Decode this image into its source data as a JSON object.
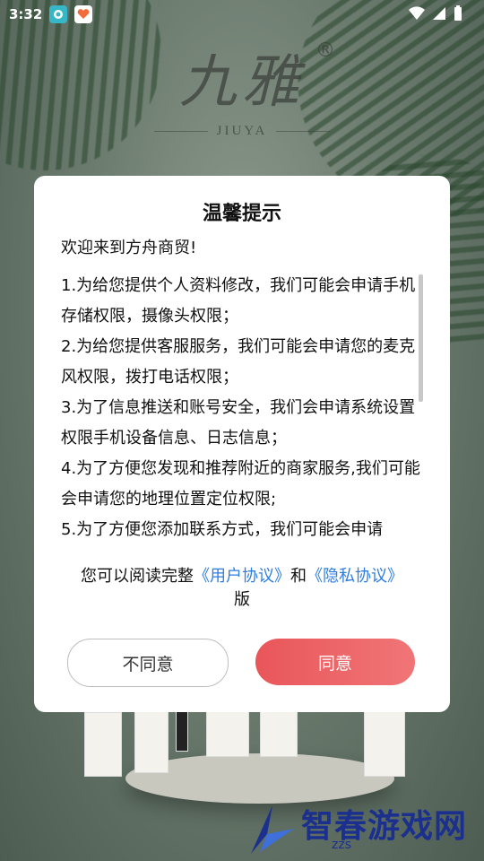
{
  "status_bar": {
    "time": "3:32"
  },
  "brand": {
    "name": "九雅",
    "mark": "®",
    "sub": "JIUYA"
  },
  "dialog": {
    "title": "温馨提示",
    "welcome": "欢迎来到方舟商贸!",
    "terms": [
      "1.为给您提供个人资料修改，我们可能会申请手机存储权限，摄像头权限；",
      "2.为给您提供客服服务，我们可能会申请您的麦克风权限，拨打电话权限；",
      "3.为了信息推送和账号安全，我们会申请系统设置权限手机设备信息、日志信息；",
      "4.为了方便您发现和推荐附近的商家服务,我们可能会申请您的地理位置定位权限;",
      "5.为了方便您添加联系方式，我们可能会申请"
    ],
    "agree_prefix": "您可以阅读完整",
    "user_agreement": "《用户协议》",
    "and": "和",
    "privacy_policy": "《隐私协议》",
    "agree_suffix": "版",
    "disagree_label": "不同意",
    "agree_label": "同意"
  },
  "watermark": {
    "text": "智春游戏网",
    "sub": "zzs"
  },
  "colors": {
    "accent": "#ee5f61",
    "link": "#2f7de1"
  }
}
